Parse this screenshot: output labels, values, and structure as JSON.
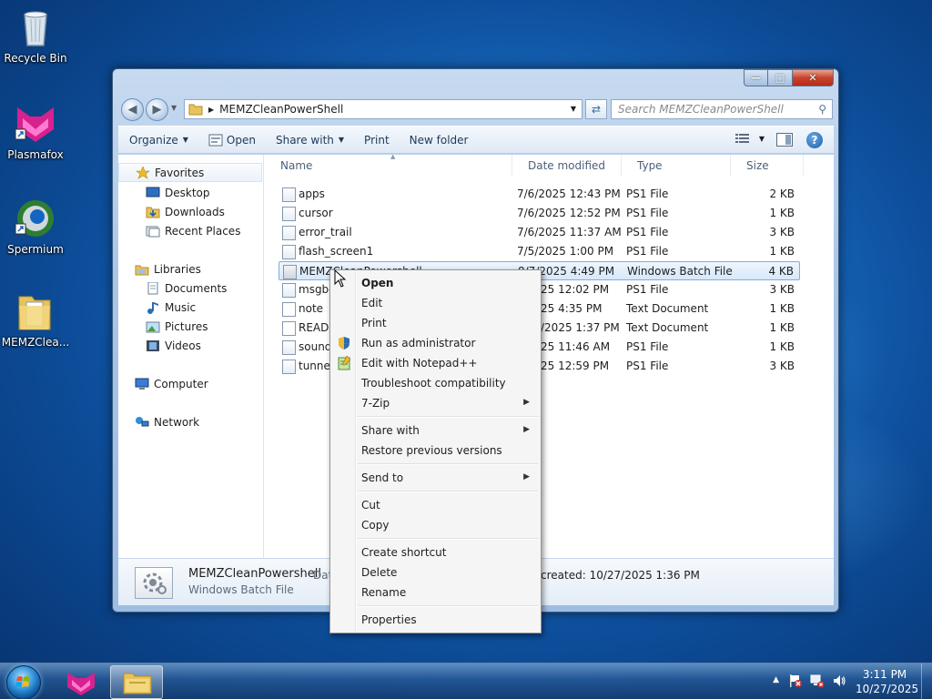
{
  "desktop": {
    "icons": [
      {
        "label": "Recycle Bin"
      },
      {
        "label": "Plasmafox"
      },
      {
        "label": "Spermium"
      },
      {
        "label": "MEMZClea..."
      }
    ]
  },
  "window": {
    "address": {
      "current": "MEMZCleanPowerShell"
    },
    "search": {
      "placeholder": "Search MEMZCleanPowerShell"
    },
    "toolbar": {
      "organize": "Organize",
      "open": "Open",
      "share_with": "Share with",
      "print": "Print",
      "new_folder": "New folder"
    },
    "nav": {
      "favorites": "Favorites",
      "desktop": "Desktop",
      "downloads": "Downloads",
      "recent_places": "Recent Places",
      "libraries": "Libraries",
      "documents": "Documents",
      "music": "Music",
      "pictures": "Pictures",
      "videos": "Videos",
      "computer": "Computer",
      "network": "Network"
    },
    "columns": {
      "name": "Name",
      "date": "Date modified",
      "type": "Type",
      "size": "Size"
    },
    "files": [
      {
        "name": "apps",
        "date": "7/6/2025 12:43 PM",
        "type": "PS1 File",
        "size": "2 KB"
      },
      {
        "name": "cursor",
        "date": "7/6/2025 12:52 PM",
        "type": "PS1 File",
        "size": "1 KB"
      },
      {
        "name": "error_trail",
        "date": "7/6/2025 11:37 AM",
        "type": "PS1 File",
        "size": "3 KB"
      },
      {
        "name": "flash_screen1",
        "date": "7/5/2025 1:00 PM",
        "type": "PS1 File",
        "size": "1 KB"
      },
      {
        "name": "MEMZCleanPowershell",
        "date": "8/7/2025 4:49 PM",
        "type": "Windows Batch File",
        "size": "4 KB"
      },
      {
        "name": "msgbo",
        "date": "25 12:02 PM",
        "type": "PS1 File",
        "size": "3 KB"
      },
      {
        "name": "note",
        "date": "25 4:35 PM",
        "type": "Text Document",
        "size": "1 KB"
      },
      {
        "name": "READM",
        "date": "/2025 1:37 PM",
        "type": "Text Document",
        "size": "1 KB"
      },
      {
        "name": "sound",
        "date": "25 11:46 AM",
        "type": "PS1 File",
        "size": "1 KB"
      },
      {
        "name": "tunnel",
        "date": "25 12:59 PM",
        "type": "PS1 File",
        "size": "3 KB"
      }
    ],
    "details": {
      "name": "MEMZCleanPowershell",
      "date_prefix": "Dat",
      "type": "Windows Batch File",
      "created": "created: 10/27/2025 1:36 PM"
    }
  },
  "context_menu": {
    "open": "Open",
    "edit": "Edit",
    "print": "Print",
    "run_as_admin": "Run as administrator",
    "edit_notepad": "Edit with Notepad++",
    "troubleshoot": "Troubleshoot compatibility",
    "sevenzip": "7-Zip",
    "share_with": "Share with",
    "restore": "Restore previous versions",
    "send_to": "Send to",
    "cut": "Cut",
    "copy": "Copy",
    "create_shortcut": "Create shortcut",
    "delete": "Delete",
    "rename": "Rename",
    "properties": "Properties"
  },
  "taskbar": {
    "time": "3:11 PM",
    "date": "10/27/2025"
  },
  "colors": {
    "accent": "#1a6fc4",
    "selection": "#d6e8fb",
    "close_button": "#c8432d"
  }
}
